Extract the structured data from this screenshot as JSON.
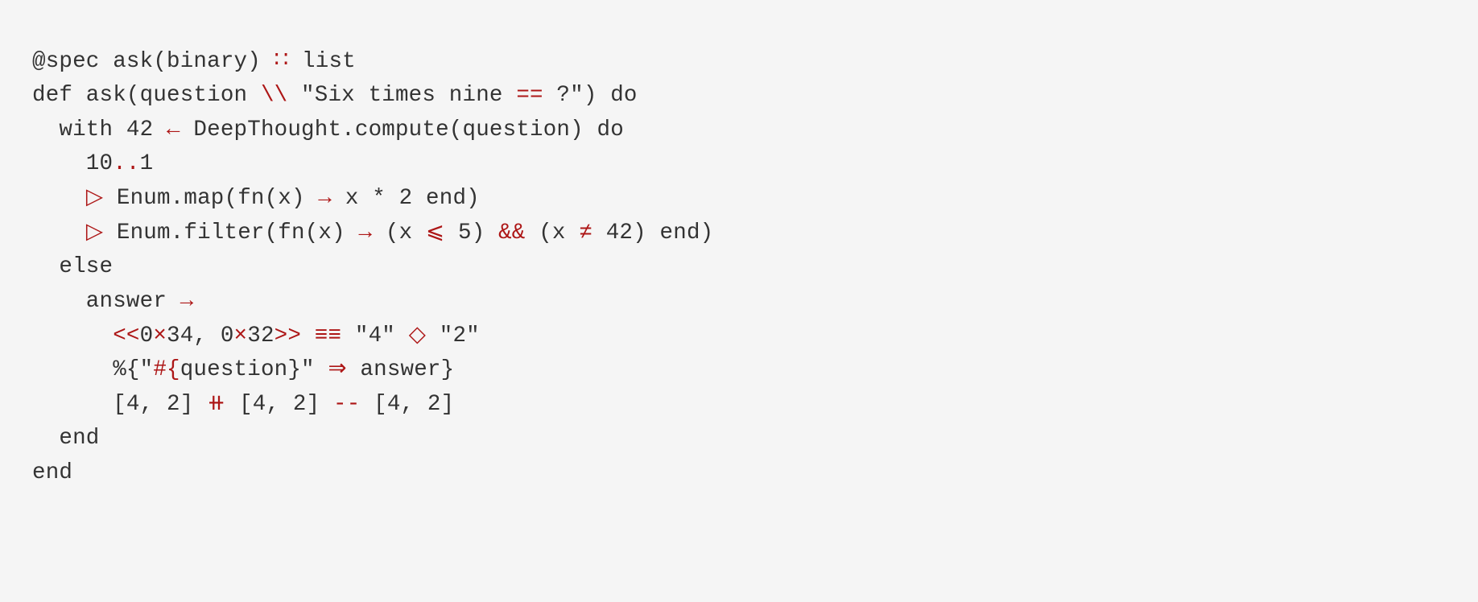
{
  "colors": {
    "background": "#f5f5f5",
    "text": "#333333",
    "operator": "#ad1616"
  },
  "code": {
    "lines": [
      [
        {
          "t": "@spec ask(binary) ",
          "c": "txt"
        },
        {
          "t": "::",
          "c": "op"
        },
        {
          "t": " list",
          "c": "txt"
        }
      ],
      [
        {
          "t": "def ask(question ",
          "c": "txt"
        },
        {
          "t": "\\\\",
          "c": "op"
        },
        {
          "t": " \"Six times nine ",
          "c": "txt"
        },
        {
          "t": "==",
          "c": "op"
        },
        {
          "t": " ?\") do",
          "c": "txt"
        }
      ],
      [
        {
          "t": "  with 42 ",
          "c": "txt"
        },
        {
          "t": "<-",
          "c": "op"
        },
        {
          "t": " DeepThought.compute(question) do",
          "c": "txt"
        }
      ],
      [
        {
          "t": "    10",
          "c": "txt"
        },
        {
          "t": "..",
          "c": "op"
        },
        {
          "t": "1",
          "c": "txt"
        }
      ],
      [
        {
          "t": "    ",
          "c": "txt"
        },
        {
          "t": "|>",
          "c": "op"
        },
        {
          "t": " Enum.map(fn(x) ",
          "c": "txt"
        },
        {
          "t": "->",
          "c": "op"
        },
        {
          "t": " x * 2 end)",
          "c": "txt"
        }
      ],
      [
        {
          "t": "    ",
          "c": "txt"
        },
        {
          "t": "|>",
          "c": "op"
        },
        {
          "t": " Enum.filter(fn(x) ",
          "c": "txt"
        },
        {
          "t": "->",
          "c": "op"
        },
        {
          "t": " (x ",
          "c": "txt"
        },
        {
          "t": "<=",
          "c": "op"
        },
        {
          "t": " 5) ",
          "c": "txt"
        },
        {
          "t": "&&",
          "c": "op"
        },
        {
          "t": " (x ",
          "c": "txt"
        },
        {
          "t": "!=",
          "c": "op"
        },
        {
          "t": " 42) end)",
          "c": "txt"
        }
      ],
      [
        {
          "t": "  else",
          "c": "txt"
        }
      ],
      [
        {
          "t": "    answer ",
          "c": "txt"
        },
        {
          "t": "->",
          "c": "op"
        }
      ],
      [
        {
          "t": "      ",
          "c": "txt"
        },
        {
          "t": "<<",
          "c": "op"
        },
        {
          "t": "0",
          "c": "txt"
        },
        {
          "t": "×",
          "c": "op"
        },
        {
          "t": "34, 0",
          "c": "txt"
        },
        {
          "t": "×",
          "c": "op"
        },
        {
          "t": "32",
          "c": "txt"
        },
        {
          "t": ">>",
          "c": "op"
        },
        {
          "t": " ",
          "c": "txt"
        },
        {
          "t": "===",
          "c": "op"
        },
        {
          "t": " \"4\" ",
          "c": "txt"
        },
        {
          "t": "<>",
          "c": "op"
        },
        {
          "t": " \"2\"",
          "c": "txt"
        }
      ],
      [
        {
          "t": "      %{\"",
          "c": "txt"
        },
        {
          "t": "#{",
          "c": "op"
        },
        {
          "t": "question}\" ",
          "c": "txt"
        },
        {
          "t": "=>",
          "c": "op"
        },
        {
          "t": " answer}",
          "c": "txt"
        }
      ],
      [
        {
          "t": "      [4, 2] ",
          "c": "txt"
        },
        {
          "t": "++",
          "c": "op"
        },
        {
          "t": " [4, 2] ",
          "c": "txt"
        },
        {
          "t": "--",
          "c": "op"
        },
        {
          "t": " [4, 2]",
          "c": "txt"
        }
      ],
      [
        {
          "t": "  end",
          "c": "txt"
        }
      ],
      [
        {
          "t": "end",
          "c": "txt"
        }
      ]
    ]
  },
  "ligatures": {
    "::": "∷",
    "\\\\": "\\\\",
    "==": "==",
    "<-": "←",
    "..": "..",
    "|>": "▷",
    "->": "→",
    "<=": "⩽",
    "&&": "&&",
    "!=": "≠",
    "<<": "<<",
    ">>": ">>",
    "===": "≡≡",
    "<>": "◇",
    "#{": "#{",
    "=>": "⇒",
    "++": "⧺",
    "--": "--",
    "×": "×"
  }
}
